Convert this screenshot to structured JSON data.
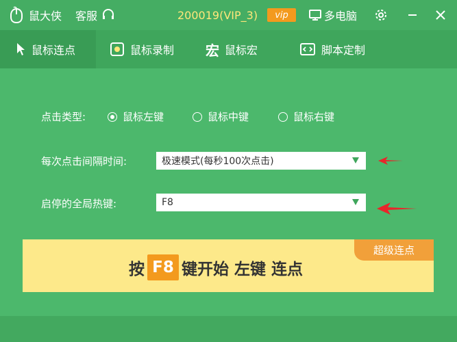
{
  "titlebar": {
    "app_name": "鼠大侠",
    "service": "客服",
    "account": "200019(VIP_3)",
    "vip_badge": "vip",
    "multi_pc": "多电脑"
  },
  "tabs": [
    {
      "label": "鼠标连点",
      "active": true
    },
    {
      "label": "鼠标录制",
      "active": false
    },
    {
      "label": "鼠标宏",
      "active": false,
      "icon_glyph": "宏"
    },
    {
      "label": "脚本定制",
      "active": false
    }
  ],
  "click_type": {
    "label": "点击类型:",
    "options": [
      "鼠标左键",
      "鼠标中键",
      "鼠标右键"
    ],
    "selected": "鼠标左键"
  },
  "interval": {
    "label": "每次点击间隔时间:",
    "value": "极速模式(每秒100次点击)"
  },
  "hotkey": {
    "label": "启停的全局热键:",
    "value": "F8"
  },
  "banner": {
    "tag": "超级连点",
    "prefix": "按",
    "key": "F8",
    "suffix": "键开始 左键 连点"
  },
  "colors": {
    "background": "#4cb86c",
    "accent_orange": "#f39a1e",
    "banner_yellow": "#fde98a",
    "account_yellow": "#ffe77a"
  }
}
